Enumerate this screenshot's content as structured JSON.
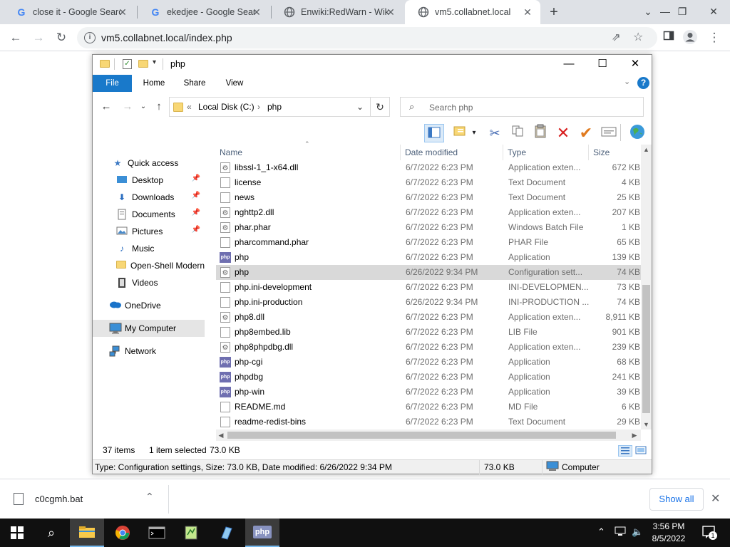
{
  "browser": {
    "tabs": [
      {
        "title": "close it - Google Search",
        "icon": "G"
      },
      {
        "title": "ekedjee - Google Search",
        "icon": "G"
      },
      {
        "title": "Enwiki:RedWarn - Wikipedia",
        "icon": "globe"
      },
      {
        "title": "vm5.collabnet.local",
        "icon": "globe"
      }
    ],
    "new_tab": "+",
    "url": "vm5.collabnet.local/index.php"
  },
  "explorer": {
    "title": "php",
    "ribbon_tabs": [
      "File",
      "Home",
      "Share",
      "View"
    ],
    "help": "?",
    "breadcrumb": [
      "Local Disk (C:)",
      "php"
    ],
    "breadcrumb_prefix": "«",
    "search_placeholder": "Search php",
    "nav": [
      {
        "label": "Quick access",
        "icon": "star-icon",
        "pinned": false
      },
      {
        "label": "Desktop",
        "icon": "desktop-icon",
        "pinned": true
      },
      {
        "label": "Downloads",
        "icon": "download-icon",
        "pinned": true
      },
      {
        "label": "Documents",
        "icon": "documents-icon",
        "pinned": true
      },
      {
        "label": "Pictures",
        "icon": "pictures-icon",
        "pinned": true
      },
      {
        "label": "Music",
        "icon": "music-icon",
        "pinned": false
      },
      {
        "label": "Open-Shell Modern",
        "icon": "folder-icon",
        "pinned": false
      },
      {
        "label": "Videos",
        "icon": "videos-icon",
        "pinned": false
      },
      {
        "label": "OneDrive",
        "icon": "cloud-icon",
        "pinned": false
      },
      {
        "label": "My Computer",
        "icon": "computer-icon",
        "pinned": false
      },
      {
        "label": "Network",
        "icon": "network-icon",
        "pinned": false
      }
    ],
    "columns": [
      "Name",
      "Date modified",
      "Type",
      "Size"
    ],
    "files": [
      {
        "name": "libssl-1_1-x64.dll",
        "date": "6/7/2022 6:23 PM",
        "type": "Application exten...",
        "size": "672 KB",
        "icon": "gear"
      },
      {
        "name": "license",
        "date": "6/7/2022 6:23 PM",
        "type": "Text Document",
        "size": "4 KB",
        "icon": "doc"
      },
      {
        "name": "news",
        "date": "6/7/2022 6:23 PM",
        "type": "Text Document",
        "size": "25 KB",
        "icon": "doc"
      },
      {
        "name": "nghttp2.dll",
        "date": "6/7/2022 6:23 PM",
        "type": "Application exten...",
        "size": "207 KB",
        "icon": "gear"
      },
      {
        "name": "phar.phar",
        "date": "6/7/2022 6:23 PM",
        "type": "Windows Batch File",
        "size": "1 KB",
        "icon": "gear"
      },
      {
        "name": "pharcommand.phar",
        "date": "6/7/2022 6:23 PM",
        "type": "PHAR File",
        "size": "65 KB",
        "icon": "doc"
      },
      {
        "name": "php",
        "date": "6/7/2022 6:23 PM",
        "type": "Application",
        "size": "139 KB",
        "icon": "exe"
      },
      {
        "name": "php",
        "date": "6/26/2022 9:34 PM",
        "type": "Configuration sett...",
        "size": "74 KB",
        "icon": "gear"
      },
      {
        "name": "php.ini-development",
        "date": "6/7/2022 6:23 PM",
        "type": "INI-DEVELOPMEN...",
        "size": "73 KB",
        "icon": "doc"
      },
      {
        "name": "php.ini-production",
        "date": "6/26/2022 9:34 PM",
        "type": "INI-PRODUCTION ...",
        "size": "74 KB",
        "icon": "doc"
      },
      {
        "name": "php8.dll",
        "date": "6/7/2022 6:23 PM",
        "type": "Application exten...",
        "size": "8,911 KB",
        "icon": "gear"
      },
      {
        "name": "php8embed.lib",
        "date": "6/7/2022 6:23 PM",
        "type": "LIB File",
        "size": "901 KB",
        "icon": "doc"
      },
      {
        "name": "php8phpdbg.dll",
        "date": "6/7/2022 6:23 PM",
        "type": "Application exten...",
        "size": "239 KB",
        "icon": "gear"
      },
      {
        "name": "php-cgi",
        "date": "6/7/2022 6:23 PM",
        "type": "Application",
        "size": "68 KB",
        "icon": "exe"
      },
      {
        "name": "phpdbg",
        "date": "6/7/2022 6:23 PM",
        "type": "Application",
        "size": "241 KB",
        "icon": "exe"
      },
      {
        "name": "php-win",
        "date": "6/7/2022 6:23 PM",
        "type": "Application",
        "size": "39 KB",
        "icon": "exe"
      },
      {
        "name": "README.md",
        "date": "6/7/2022 6:23 PM",
        "type": "MD File",
        "size": "6 KB",
        "icon": "doc"
      },
      {
        "name": "readme-redist-bins",
        "date": "6/7/2022 6:23 PM",
        "type": "Text Document",
        "size": "29 KB",
        "icon": "doc"
      }
    ],
    "selected_index": 7,
    "status": {
      "items": "37 items",
      "selected": "1 item selected",
      "size": "73.0 KB"
    },
    "details_bar": {
      "info": "Type: Configuration settings, Size: 73.0 KB, Date modified: 6/26/2022 9:34 PM",
      "size": "73.0 KB",
      "location": "Computer"
    }
  },
  "download": {
    "filename": "c0cgmh.bat",
    "show_all": "Show all"
  },
  "taskbar": {
    "time": "3:56 PM",
    "date": "8/5/2022",
    "notifications": "1",
    "php_label": "php"
  }
}
